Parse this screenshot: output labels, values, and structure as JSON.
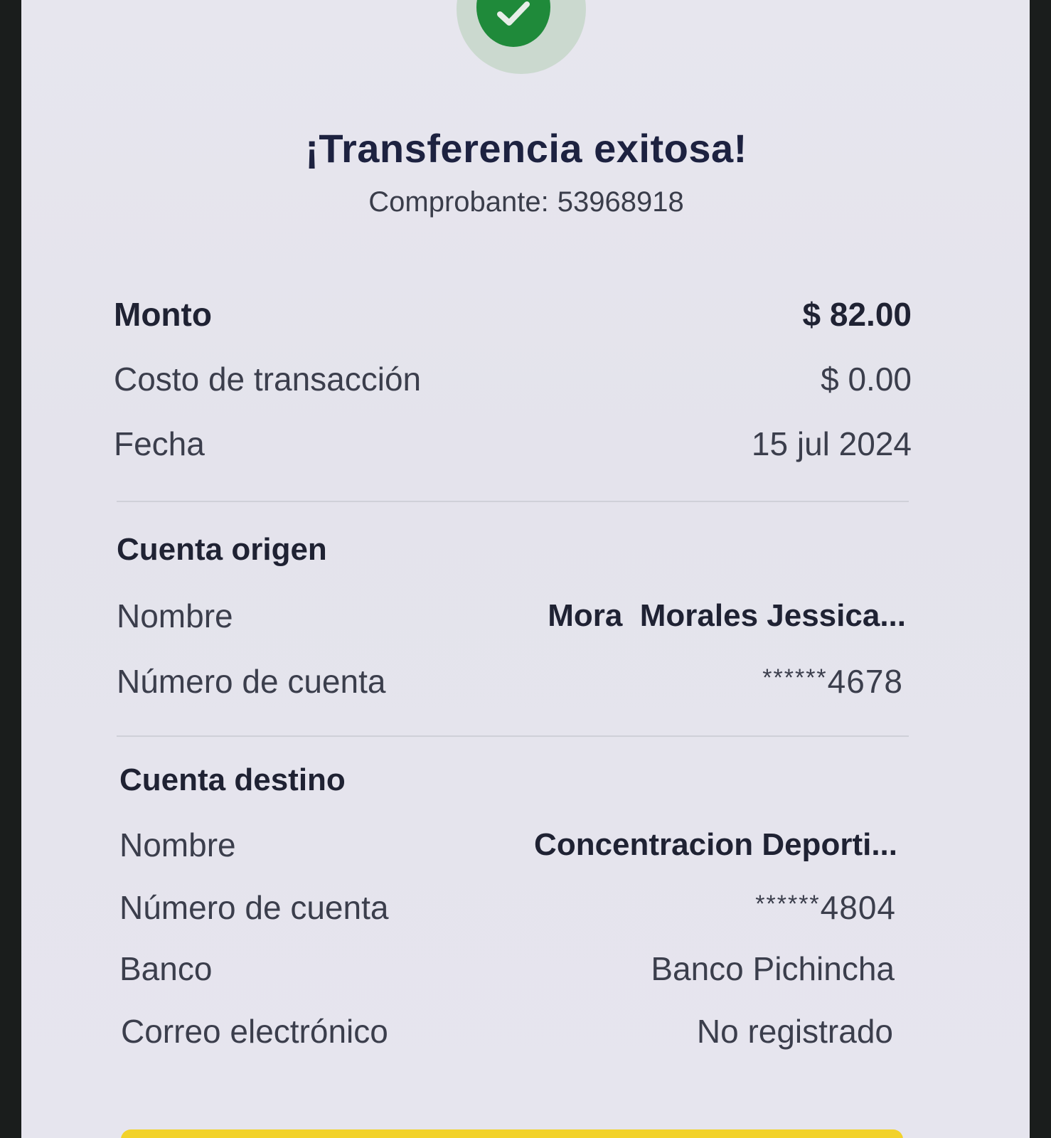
{
  "header": {
    "title": "¡Transferencia exitosa!",
    "voucher_label": "Comprobante:",
    "voucher_number": "53968918"
  },
  "summary": {
    "amount_label": "Monto",
    "amount_value": "$ 82.00",
    "fee_label": "Costo de transacción",
    "fee_value": "$ 0.00",
    "date_label": "Fecha",
    "date_value": "15 jul 2024"
  },
  "origin": {
    "section_title": "Cuenta origen",
    "name_label": "Nombre",
    "name_value": "Mora  Morales Jessica...",
    "account_label": "Número de cuenta",
    "account_mask": "******",
    "account_last": "4678"
  },
  "destination": {
    "section_title": "Cuenta destino",
    "name_label": "Nombre",
    "name_value": "Concentracion Deporti...",
    "account_label": "Número de cuenta",
    "account_mask": "******",
    "account_last": "4804",
    "bank_label": "Banco",
    "bank_value": "Banco Pichincha",
    "email_label": "Correo electrónico",
    "email_value": "No registrado"
  },
  "colors": {
    "success": "#1f8a3a",
    "title": "#1d2240",
    "accent_bar": "#f2d22a"
  },
  "icons": {
    "status": "check-icon"
  }
}
